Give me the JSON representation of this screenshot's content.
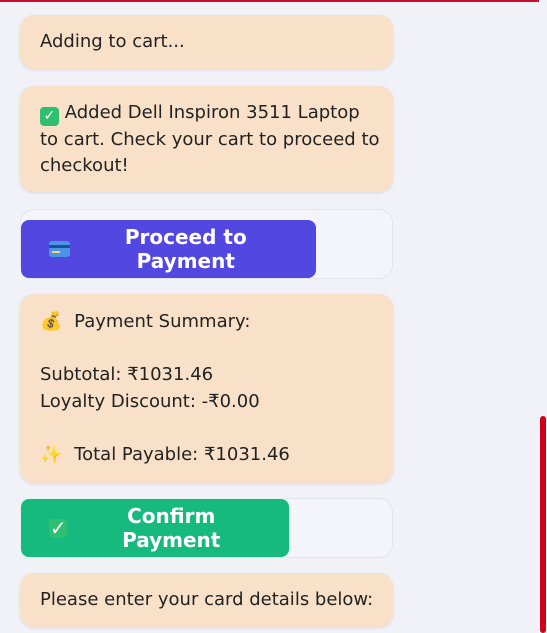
{
  "chat": {
    "messages": [
      {
        "text": "Adding to cart..."
      },
      {
        "icon": "check-mark-icon",
        "lines": [
          "Added Dell Inspiron 3511 Laptop",
          "to cart. Check your cart to proceed to",
          "checkout!"
        ]
      },
      {
        "summary_icon": "money-bag-icon",
        "title": "Payment Summary:",
        "subtotal": "Subtotal: ₹1031.46",
        "discount": "Loyalty Discount: -₹0.00",
        "total_icon": "sparkles-icon",
        "total": "Total Payable: ₹1031.46"
      },
      {
        "text": "Please enter your card details below:"
      }
    ]
  },
  "buttons": {
    "proceed_payment": {
      "icon": "credit-card-icon",
      "label": "Proceed to Payment"
    },
    "confirm_payment": {
      "icon": "check-mark-icon",
      "label": "Confirm Payment"
    }
  },
  "colors": {
    "bubble_bg": "#f8e1c8",
    "proceed_bg": "#5247e0",
    "confirm_bg": "#16b97e",
    "page_bg": "#f1f2f8",
    "accent_bar": "#c8102e"
  }
}
